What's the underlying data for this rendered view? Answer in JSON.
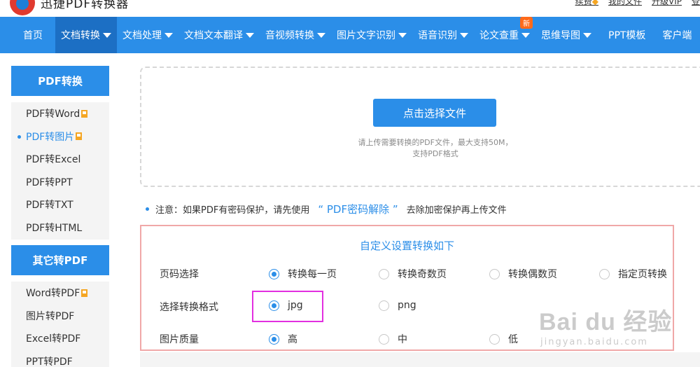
{
  "header": {
    "site_title": "迅捷PDF转换器",
    "links": [
      "续费",
      "我的文件",
      "升级VIP",
      "登"
    ]
  },
  "nav": {
    "items": [
      {
        "label": "首页",
        "caret": false
      },
      {
        "label": "文档转换",
        "caret": true,
        "active": true
      },
      {
        "label": "文档处理",
        "caret": true
      },
      {
        "label": "文档文本翻译",
        "caret": true
      },
      {
        "label": "音视频转换",
        "caret": true
      },
      {
        "label": "图片文字识别",
        "caret": true
      },
      {
        "label": "语音识别",
        "caret": true
      },
      {
        "label": "论文查重",
        "caret": true,
        "badge": "新"
      },
      {
        "label": "思维导图",
        "caret": true
      },
      {
        "label": "PPT模板",
        "caret": false
      },
      {
        "label": "客户端",
        "caret": false
      }
    ]
  },
  "sidebar": {
    "pdf_convert": {
      "heading": "PDF转换",
      "items": [
        "PDF转Word",
        "PDF转图片",
        "PDF转Excel",
        "PDF转PPT",
        "PDF转TXT",
        "PDF转HTML"
      ]
    },
    "other_to_pdf": {
      "heading": "其它转PDF",
      "items": [
        "Word转PDF",
        "图片转PDF",
        "Excel转PDF",
        "PPT转PDF"
      ]
    }
  },
  "upload": {
    "button": "点击选择文件",
    "tip_line1": "请上传需要转换的PDF文件，最大支持50M，",
    "tip_line2": "支持PDF格式"
  },
  "note": {
    "prefix": "注意：如果PDF有密码保护，请先使用",
    "link": "“ PDF密码解除 ”",
    "suffix": "去除加密保护再上传文件"
  },
  "settings": {
    "title": "自定义设置转换如下",
    "page_select": {
      "label": "页码选择",
      "options": [
        "转换每一页",
        "转换奇数页",
        "转换偶数页",
        "指定页转换"
      ],
      "selected": "转换每一页"
    },
    "format": {
      "label": "选择转换格式",
      "options": [
        "jpg",
        "png"
      ],
      "selected": "jpg"
    },
    "quality": {
      "label": "图片质量",
      "options": [
        "高",
        "中",
        "低"
      ],
      "selected": "高"
    }
  },
  "watermark": {
    "main": "Bai du 经验",
    "sub": "jingyan.baidu.com"
  },
  "colors": {
    "accent": "#2b8ee8",
    "nav_active": "#1c6fc4",
    "highlight": "#e22fe0",
    "settings_border": "#f0a8a8",
    "bookmark": "#f5a623"
  }
}
